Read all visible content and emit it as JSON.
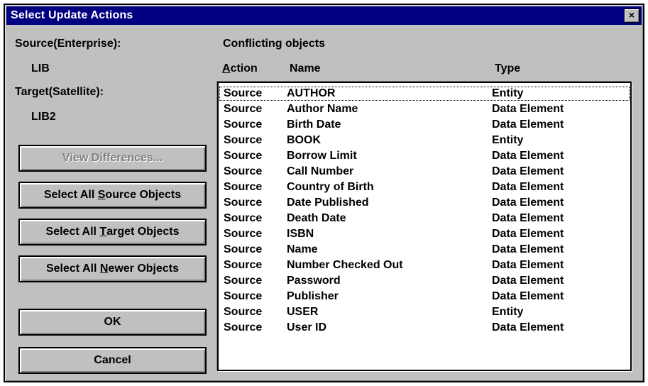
{
  "window": {
    "title": "Select Update Actions",
    "close_symbol": "×"
  },
  "left": {
    "source_label": "Source(Enterprise):",
    "source_value": "LIB",
    "target_label": "Target(Satellite):",
    "target_value": "LIB2"
  },
  "buttons": {
    "view_differences": {
      "underline": "V",
      "rest": "iew Differences..."
    },
    "select_source": {
      "pre": "Select All ",
      "underline": "S",
      "post": "ource Objects"
    },
    "select_target": {
      "pre": "Select All ",
      "underline": "T",
      "post": "arget Objects"
    },
    "select_newer": {
      "pre": "Select All ",
      "underline": "N",
      "post": "ewer Objects"
    },
    "ok": "OK",
    "cancel": "Cancel"
  },
  "list": {
    "heading": "Conflicting objects",
    "columns": {
      "action_underline": "A",
      "action_rest": "ction",
      "name": "Name",
      "type": "Type"
    },
    "rows": [
      {
        "action": "Source",
        "name": "AUTHOR",
        "type": "Entity",
        "selected": true
      },
      {
        "action": "Source",
        "name": "Author Name",
        "type": "Data Element"
      },
      {
        "action": "Source",
        "name": "Birth Date",
        "type": "Data Element"
      },
      {
        "action": "Source",
        "name": "BOOK",
        "type": "Entity"
      },
      {
        "action": "Source",
        "name": "Borrow Limit",
        "type": "Data Element"
      },
      {
        "action": "Source",
        "name": "Call Number",
        "type": "Data Element"
      },
      {
        "action": "Source",
        "name": "Country of Birth",
        "type": "Data Element"
      },
      {
        "action": "Source",
        "name": "Date Published",
        "type": "Data Element"
      },
      {
        "action": "Source",
        "name": "Death Date",
        "type": "Data Element"
      },
      {
        "action": "Source",
        "name": "ISBN",
        "type": "Data Element"
      },
      {
        "action": "Source",
        "name": "Name",
        "type": "Data Element"
      },
      {
        "action": "Source",
        "name": "Number Checked Out",
        "type": "Data Element"
      },
      {
        "action": "Source",
        "name": "Password",
        "type": "Data Element"
      },
      {
        "action": "Source",
        "name": "Publisher",
        "type": "Data Element"
      },
      {
        "action": "Source",
        "name": "USER",
        "type": "Entity"
      },
      {
        "action": "Source",
        "name": "User ID",
        "type": "Data Element"
      }
    ]
  }
}
